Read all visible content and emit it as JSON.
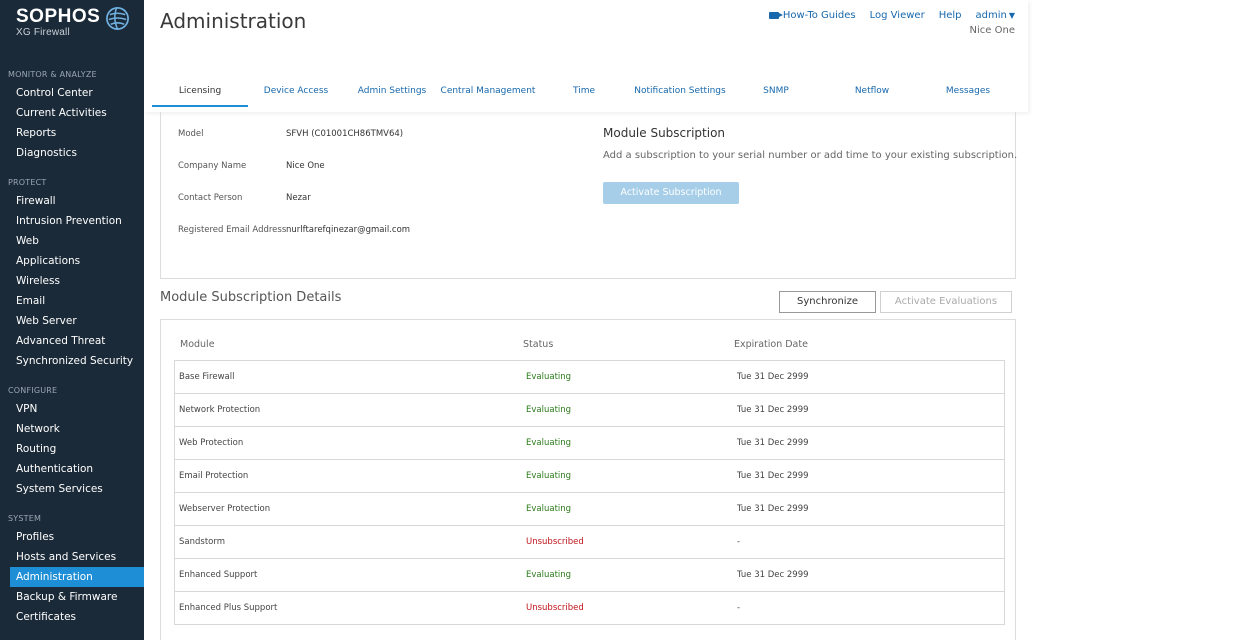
{
  "brand": {
    "name": "SOPHOS",
    "product": "XG Firewall"
  },
  "sidebar": {
    "sections": [
      {
        "heading": "MONITOR & ANALYZE",
        "items": [
          "Control Center",
          "Current Activities",
          "Reports",
          "Diagnostics"
        ]
      },
      {
        "heading": "PROTECT",
        "items": [
          "Firewall",
          "Intrusion Prevention",
          "Web",
          "Applications",
          "Wireless",
          "Email",
          "Web Server",
          "Advanced Threat",
          "Synchronized Security"
        ]
      },
      {
        "heading": "CONFIGURE",
        "items": [
          "VPN",
          "Network",
          "Routing",
          "Authentication",
          "System Services"
        ]
      },
      {
        "heading": "SYSTEM",
        "items": [
          "Profiles",
          "Hosts and Services",
          "Administration",
          "Backup & Firmware",
          "Certificates"
        ]
      }
    ],
    "active_item": "Administration"
  },
  "header": {
    "title": "Administration",
    "links": {
      "howto": "How-To Guides",
      "log_viewer": "Log Viewer",
      "help": "Help",
      "admin": "admin"
    },
    "company": "Nice One"
  },
  "tabs": [
    "Licensing",
    "Device Access",
    "Admin Settings",
    "Central Management",
    "Time",
    "Notification Settings",
    "SNMP",
    "Netflow",
    "Messages"
  ],
  "license": {
    "model_label": "Model",
    "model_value": "SFVH (C01001CH86TMV64)",
    "company_label": "Company Name",
    "company_value": "Nice One",
    "contact_label": "Contact Person",
    "contact_value": "Nezar",
    "email_label": "Registered Email Address",
    "email_value": "nurlftarefqinezar@gmail.com",
    "module_sub_title": "Module Subscription",
    "module_sub_desc": "Add a subscription to your serial number or add time to your existing subscription.",
    "activate_sub_label": "Activate Subscription"
  },
  "details": {
    "title": "Module Subscription Details",
    "sync_label": "Synchronize",
    "eval_label": "Activate Evaluations",
    "columns": [
      "Module",
      "Status",
      "Expiration Date"
    ],
    "rows": [
      {
        "module": "Base Firewall",
        "status": "Evaluating",
        "expiry": "Tue 31 Dec 2999"
      },
      {
        "module": "Network Protection",
        "status": "Evaluating",
        "expiry": "Tue 31 Dec 2999"
      },
      {
        "module": "Web Protection",
        "status": "Evaluating",
        "expiry": "Tue 31 Dec 2999"
      },
      {
        "module": "Email Protection",
        "status": "Evaluating",
        "expiry": "Tue 31 Dec 2999"
      },
      {
        "module": "Webserver Protection",
        "status": "Evaluating",
        "expiry": "Tue 31 Dec 2999"
      },
      {
        "module": "Sandstorm",
        "status": "Unsubscribed",
        "expiry": "-"
      },
      {
        "module": "Enhanced Support",
        "status": "Evaluating",
        "expiry": "Tue 31 Dec 2999"
      },
      {
        "module": "Enhanced Plus Support",
        "status": "Unsubscribed",
        "expiry": "-"
      }
    ]
  },
  "colors": {
    "sidebar_bg": "#1b2a38",
    "accent": "#1e8fd6",
    "link": "#1768ac",
    "evaluating": "#2a7a1a",
    "unsubscribed": "#c0141a"
  }
}
